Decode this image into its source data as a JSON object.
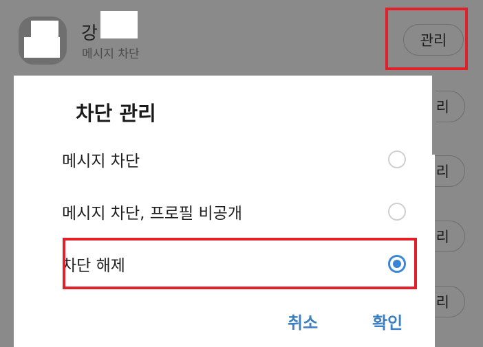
{
  "contact": {
    "name": "강",
    "status": "메시지 차단",
    "manage_label": "관리"
  },
  "background_buttons": [
    "리",
    "리",
    "리",
    "리"
  ],
  "dialog": {
    "title": "차단 관리",
    "options": [
      {
        "label": "메시지 차단",
        "selected": false
      },
      {
        "label": "메시지 차단, 프로필 비공개",
        "selected": false
      },
      {
        "label": "차단 해제",
        "selected": true
      }
    ],
    "cancel_label": "취소",
    "confirm_label": "확인"
  },
  "colors": {
    "overlay": "#8a8a8a",
    "accent": "#3a86d4",
    "highlight": "#e0202a"
  }
}
